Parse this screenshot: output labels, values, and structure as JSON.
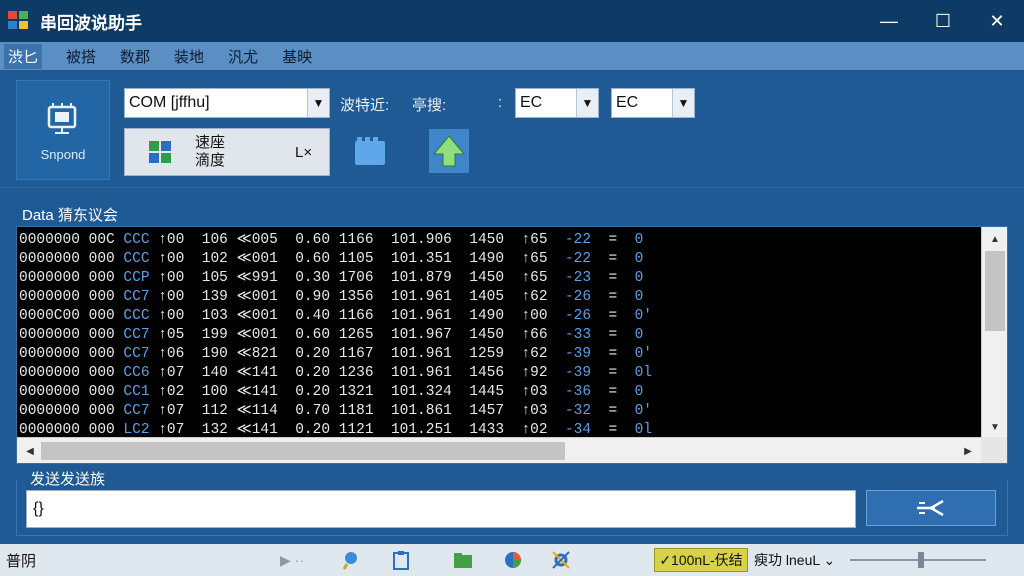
{
  "window": {
    "title": "串回波说助手",
    "minimize_label": "—",
    "maximize_label": "☐",
    "close_label": "✕"
  },
  "menu": {
    "items": [
      "渋匕",
      "被搭",
      "数郡",
      "装地",
      "汎尤",
      "基映"
    ]
  },
  "toolbar": {
    "connect_label": "Snpond",
    "port_value": "COM [jffhu]",
    "baud_label": "波特近:",
    "stop_label": "亭搜:",
    "colon_label": ":",
    "baud_value": "EC",
    "data_value": "EC",
    "open_text_line1": "速座",
    "open_text_line2": "滴度",
    "open_suffix": "L×"
  },
  "data_section": {
    "label": "Data 猜东议会",
    "rows": [
      [
        "0000000 00C ",
        "CCC",
        " ↑00  106 ≪005  0.60 1166  101.906  1450  ↑65  ",
        "-22",
        "  =  ",
        "0"
      ],
      [
        "0000000 000 ",
        "CCC",
        " ↑00  102 ≪001  0.60 1105  101.351  1490  ↑65  ",
        "-22",
        "  =  ",
        "0"
      ],
      [
        "0000000 000 ",
        "CCP",
        " ↑00  105 ≪991  0.30 1706  101.879  1450  ↑65  ",
        "-23",
        "  =  ",
        "0"
      ],
      [
        "0000000 000 ",
        "CC7",
        " ↑00  139 ≪001  0.90 1356  101.961  1405  ↑62  ",
        "-26",
        "  =  ",
        "0"
      ],
      [
        "0000C00 000 ",
        "CCC",
        " ↑00  103 ≪001  0.40 1166  101.961  1490  ↑00  ",
        "-26",
        "  =  ",
        "0'"
      ],
      [
        "0000000 000 ",
        "CC7",
        " ↑05  199 ≪001  0.60 1265  101.967  1450  ↑66  ",
        "-33",
        "  =  ",
        "0"
      ],
      [
        "0000000 000 ",
        "CC7",
        " ↑06  190 ≪821  0.20 1167  101.961  1259  ↑62  ",
        "-39",
        "  =  ",
        "0'"
      ],
      [
        "0000000 000 ",
        "CC6",
        " ↑07  140 ≪141  0.20 1236  101.961  1456  ↑92  ",
        "-39",
        "  =  ",
        "0l"
      ],
      [
        "0000000 000 ",
        "CC1",
        " ↑02  100 ≪141  0.20 1321  101.324  1445  ↑03  ",
        "-36",
        "  =  ",
        "0"
      ],
      [
        "0000000 000 ",
        "CC7",
        " ↑07  112 ≪114  0.70 1181  101.861  1457  ↑03  ",
        "-32",
        "  =  ",
        "0'"
      ],
      [
        "0000000 000 ",
        "LC2",
        " ↑07  132 ≪141  0.20 1121  101.251  1433  ↑02  ",
        "-34",
        "  =  ",
        "0l"
      ]
    ]
  },
  "send": {
    "label": "发送发送族",
    "input_value": "{}"
  },
  "status": {
    "left_text": "普阴",
    "badge_text": "✓100nL-仸结",
    "right_text": "瘐功 lneuL ⌄"
  },
  "colors": {
    "title_bg": "#0e3a66",
    "panel_bg": "#1f5a94",
    "menu_bg": "#5b8ec2",
    "accent_blue": "#5aa0e6",
    "badge_bg": "#d8d24a"
  },
  "icons": {
    "app": "app-icon",
    "connect": "chip-monitor-icon",
    "open": "windows-logo-icon",
    "tool1": "folder-blue-icon",
    "tool2": "arrow-up-icon",
    "send": "send-arrow-icon"
  },
  "slider": {
    "value": 0.52
  }
}
